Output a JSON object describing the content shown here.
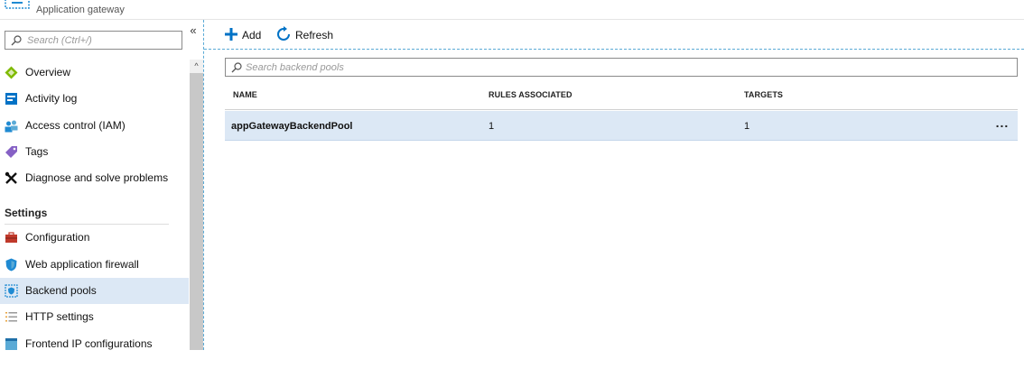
{
  "header": {
    "subtitle": "Application gateway",
    "logo_icon": "application-gateway-icon"
  },
  "sidebar": {
    "search_placeholder": "Search (Ctrl+/)",
    "collapse_icon": "double-chevron-left-icon",
    "items": [
      {
        "label": "Overview",
        "icon": "overview-diamond-icon"
      },
      {
        "label": "Activity log",
        "icon": "activity-log-icon"
      },
      {
        "label": "Access control (IAM)",
        "icon": "people-icon"
      },
      {
        "label": "Tags",
        "icon": "tag-icon"
      },
      {
        "label": "Diagnose and solve problems",
        "icon": "wrench-cross-icon"
      }
    ],
    "settings_header": "Settings",
    "settings_items": [
      {
        "label": "Configuration",
        "icon": "toolbox-icon"
      },
      {
        "label": "Web application firewall",
        "icon": "shield-icon"
      },
      {
        "label": "Backend pools",
        "icon": "backend-pool-icon",
        "active": true
      },
      {
        "label": "HTTP settings",
        "icon": "list-settings-icon"
      },
      {
        "label": "Frontend IP configurations",
        "icon": "frontend-ip-icon"
      }
    ]
  },
  "toolbar": {
    "add_label": "Add",
    "refresh_label": "Refresh"
  },
  "main": {
    "search_placeholder": "Search backend pools",
    "columns": [
      "NAME",
      "RULES ASSOCIATED",
      "TARGETS"
    ],
    "rows": [
      {
        "name": "appGatewayBackendPool",
        "rules": "1",
        "targets": "1",
        "more": "..."
      }
    ]
  },
  "colors": {
    "accent": "#0072c6",
    "selected_row": "#dce8f5",
    "dashed_border": "#5aaad6"
  }
}
